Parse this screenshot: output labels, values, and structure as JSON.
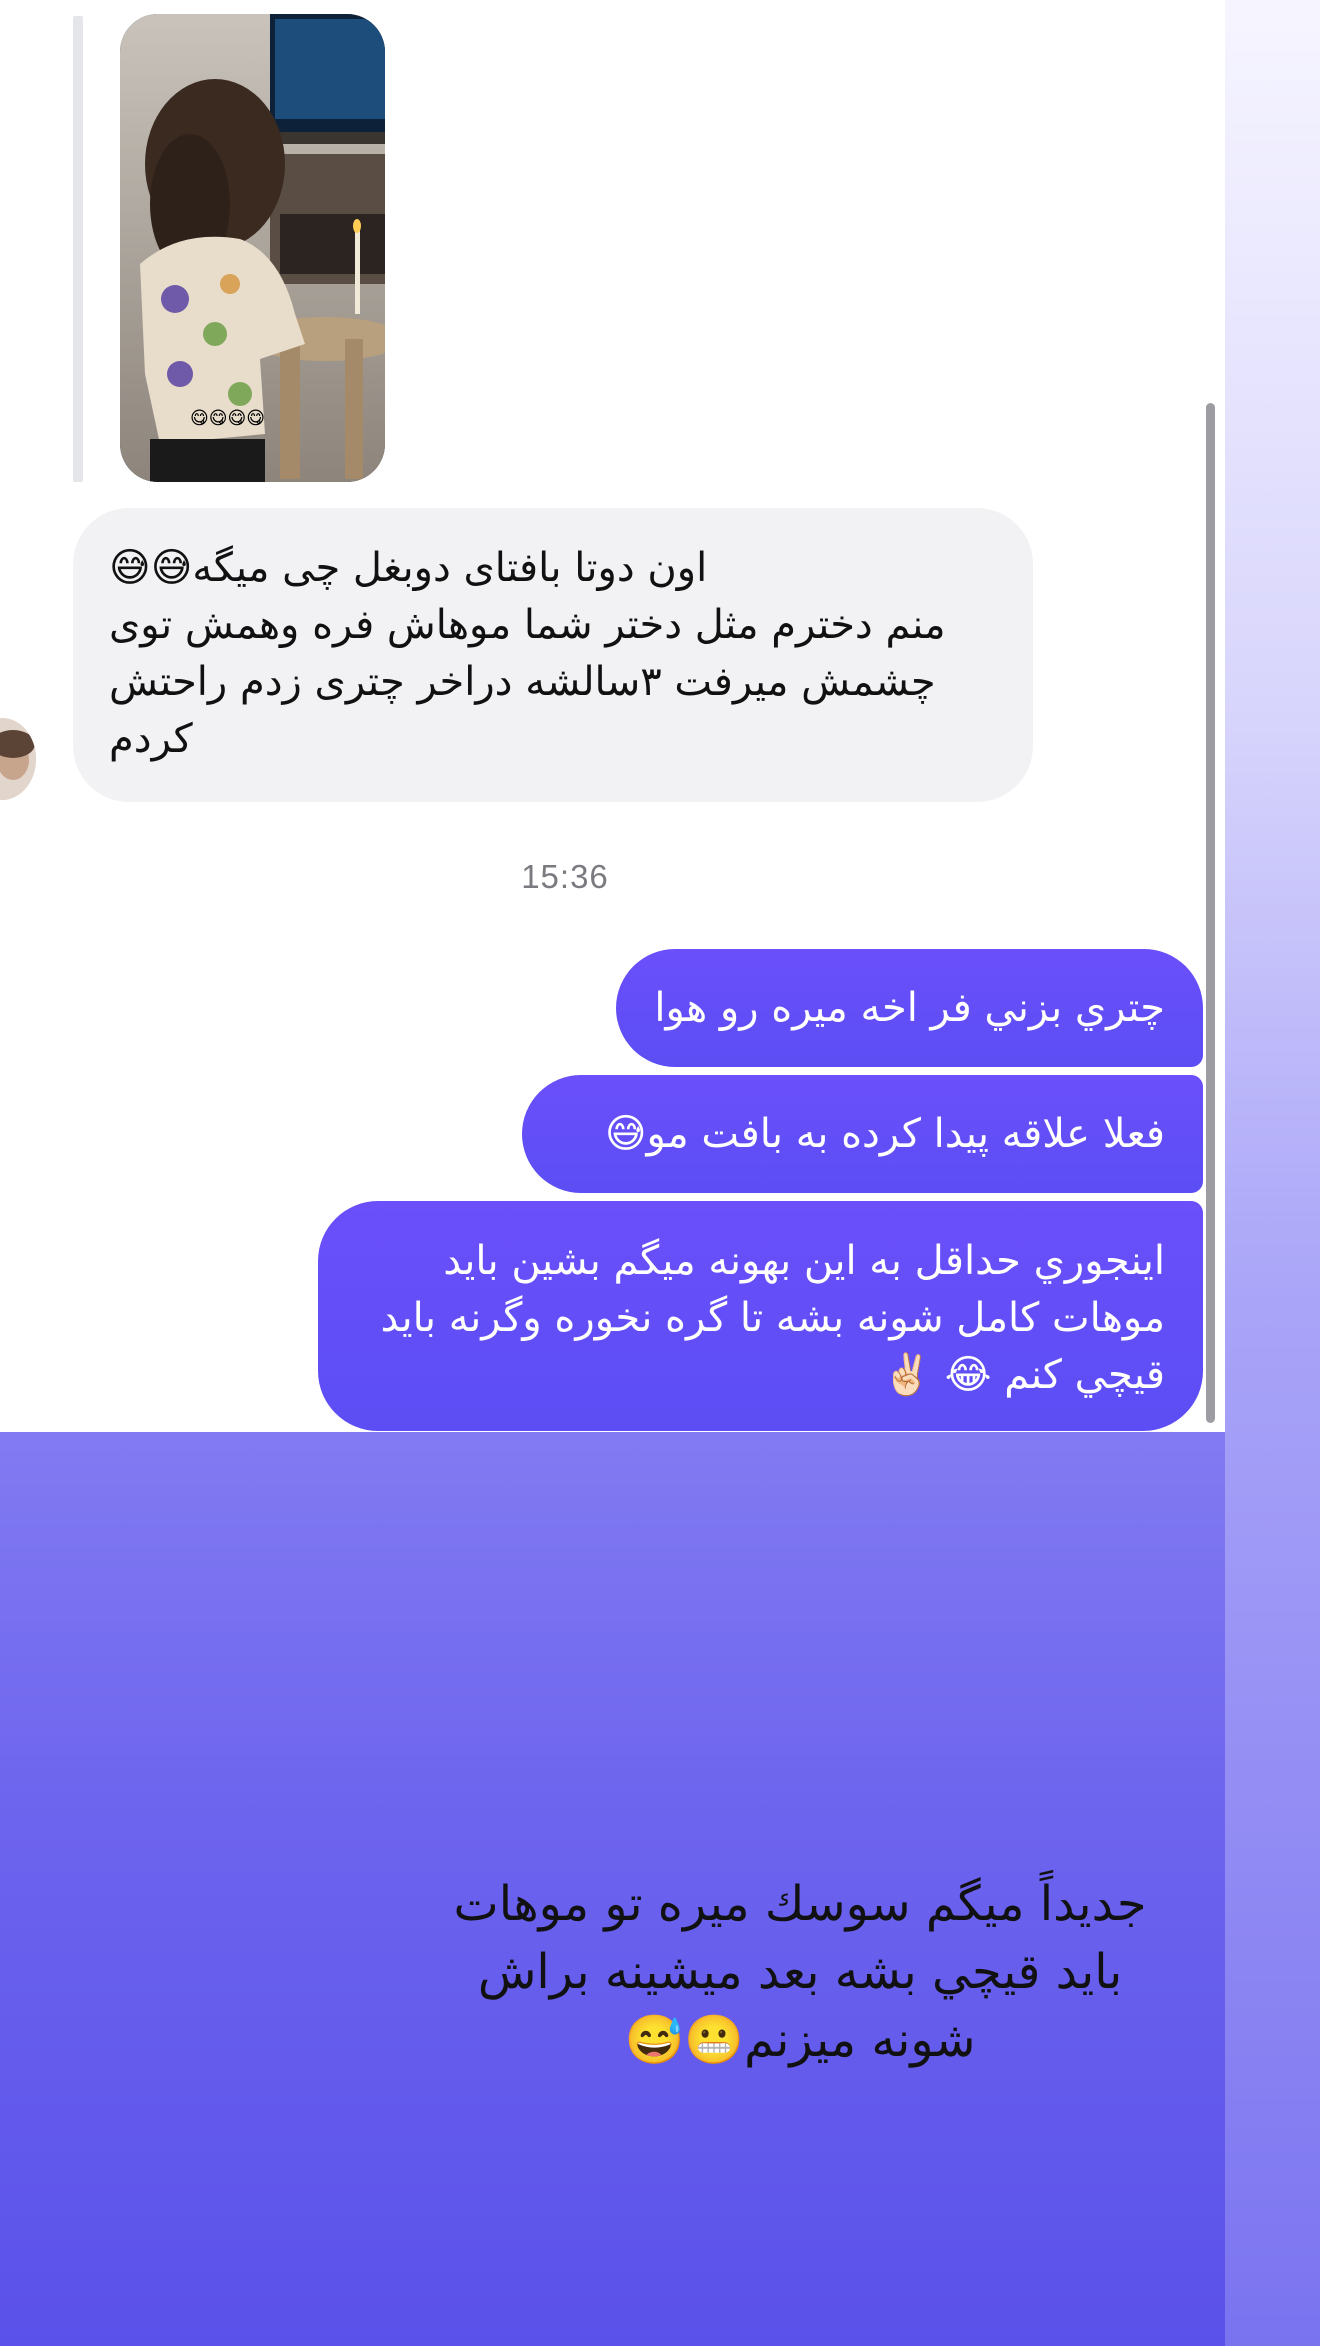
{
  "conversation": {
    "story_reply": {
      "image_alt": "story photo of a curly-haired girl at a table with a candle",
      "sticker_text": "😋😋😋😋"
    },
    "incoming_message": {
      "lines": [
        "اون دوتا بافتای دوبغل چی میگه😅😅",
        "منم دخترم مثل دختر شما موهاش فره وهمش توی",
        "چشمش میرفت ۳سالشه دراخر چتری زدم راحتش",
        "کردم"
      ]
    },
    "timestamp": "15:36",
    "outgoing_messages": [
      {
        "lines": [
          "چتري بزني فر اخه ميره رو هوا"
        ]
      },
      {
        "lines": [
          "فعلا علاقه پيدا كرده به بافت مو😅"
        ]
      },
      {
        "lines": [
          "اينجوري حداقل به اين بهونه ميگم بشين بايد",
          "موهات كامل شونه بشه تا گره نخوره وگرنه بايد",
          "قيچي كنم 😂 ✌🏻"
        ]
      }
    ]
  },
  "story_caption": {
    "lines": [
      "جديداً ميگم سوسك ميره تو موهات",
      "بايد قيچي بشه بعد ميشينه براش",
      "شونه ميزنم😬😅"
    ]
  },
  "colors": {
    "outgoing_bubble": "#5f4ef7",
    "incoming_bubble": "#f2f2f4",
    "background_gradient_end": "#5a51ea"
  }
}
